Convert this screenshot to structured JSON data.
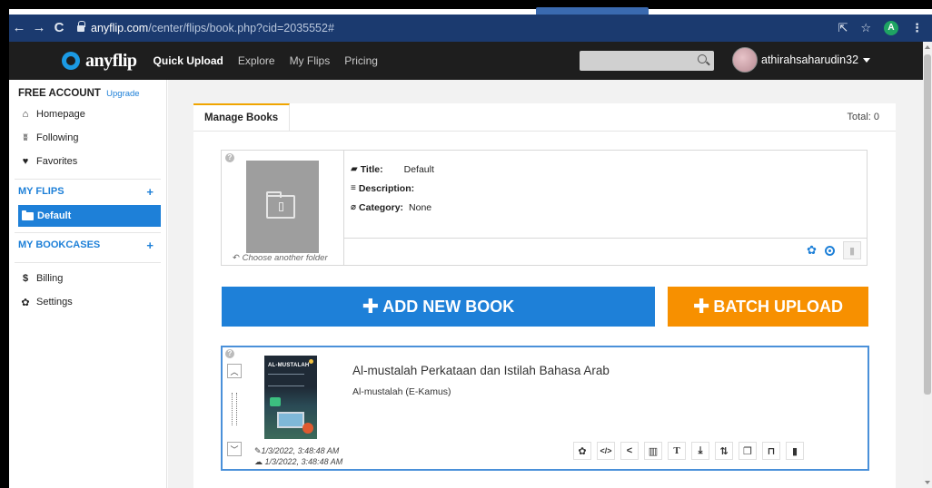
{
  "browser": {
    "url_host": "anyflip.com",
    "url_path": "/center/flips/book.php?cid=2035552#",
    "profile_initial": "A"
  },
  "header": {
    "logo_text": "anyflip",
    "nav": [
      "Quick Upload",
      "Explore",
      "My Flips",
      "Pricing"
    ],
    "username": "athirahsaharudin32"
  },
  "sidebar": {
    "account_label": "FREE ACCOUNT",
    "upgrade_label": "Upgrade",
    "items": [
      "Homepage",
      "Following",
      "Favorites"
    ],
    "my_flips_label": "MY FLIPS",
    "active_folder": "Default",
    "my_bookcases_label": "MY BOOKCASES",
    "bottom_items": [
      "Billing",
      "Settings"
    ]
  },
  "main": {
    "tab_label": "Manage Books",
    "total_label": "Total: 0",
    "folder": {
      "choose_label": "Choose another folder",
      "title_label": "Title:",
      "title_value": "Default",
      "description_label": "Description:",
      "category_label": "Category:",
      "category_value": "None"
    },
    "add_book_label": "ADD NEW BOOK",
    "batch_upload_label": "BATCH UPLOAD",
    "book": {
      "cover_title": "AL-MUSTALAH",
      "title": "Al-mustalah Perkataan dan Istilah Bahasa Arab",
      "subtitle": "Al-mustalah (E-Kamus)",
      "modified": "1/3/2022, 3:48:48 AM",
      "uploaded": "1/3/2022, 3:48:48 AM"
    }
  },
  "colors": {
    "primary_blue": "#1e80d8",
    "batch_orange": "#f79000",
    "header_dark": "#1e1e1e",
    "tab_accent": "#f0a500"
  }
}
